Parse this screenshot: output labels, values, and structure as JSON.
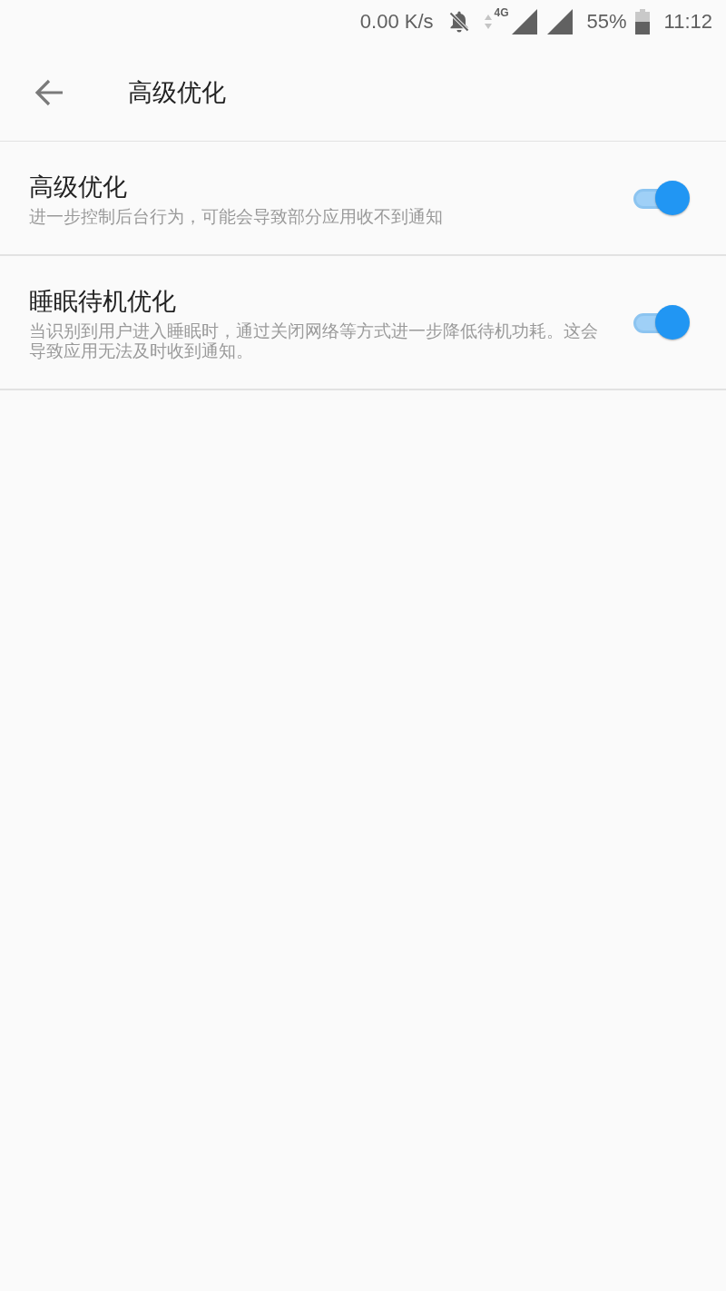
{
  "status_bar": {
    "network_speed": "0.00 K/s",
    "network_type": "4G",
    "battery": "55%",
    "time": "11:12"
  },
  "header": {
    "title": "高级优化"
  },
  "settings": [
    {
      "title": "高级优化",
      "description": "进一步控制后台行为，可能会导致部分应用收不到通知",
      "on": true
    },
    {
      "title": "睡眠待机优化",
      "description": "当识别到用户进入睡眠时，通过关闭网络等方式进一步降低待机功耗。这会导致应用无法及时收到通知。",
      "on": true
    }
  ]
}
